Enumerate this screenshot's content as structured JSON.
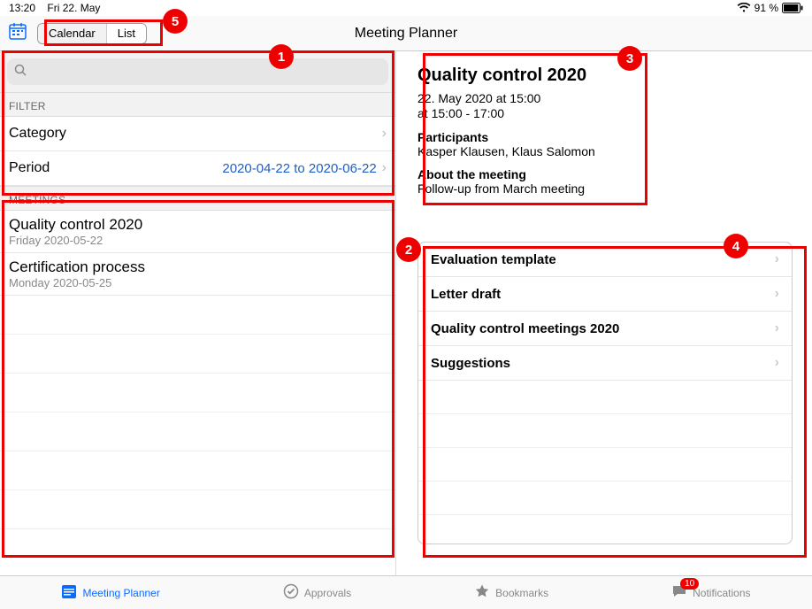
{
  "status": {
    "time": "13:20",
    "date": "Fri 22. May",
    "battery_percent": "91 %"
  },
  "nav": {
    "seg_calendar": "Calendar",
    "seg_list": "List",
    "title": "Meeting Planner"
  },
  "filter": {
    "header": "FILTER",
    "category_label": "Category",
    "period_label": "Period",
    "period_value": "2020-04-22 to 2020-06-22"
  },
  "meetings": {
    "header": "MEETINGS",
    "items": [
      {
        "title": "Quality control 2020",
        "sub": "Friday 2020-05-22"
      },
      {
        "title": "Certification process",
        "sub": "Monday 2020-05-25"
      }
    ]
  },
  "detail": {
    "title": "Quality control 2020",
    "date_line": "22. May 2020 at 15:00",
    "time_line": "at 15:00 - 17:00",
    "participants_label": "Participants",
    "participants": "Kasper Klausen, Klaus Salomon",
    "about_label": "About the meeting",
    "about": "Follow-up from March meeting"
  },
  "documents": {
    "items": [
      {
        "label": "Evaluation template"
      },
      {
        "label": "Letter draft"
      },
      {
        "label": "Quality control meetings 2020"
      },
      {
        "label": "Suggestions"
      }
    ]
  },
  "tabs": {
    "planner": "Meeting Planner",
    "approvals": "Approvals",
    "bookmarks": "Bookmarks",
    "notifications": "Notifications",
    "badge": "10"
  },
  "annotations": {
    "a1": "1",
    "a2": "2",
    "a3": "3",
    "a4": "4",
    "a5": "5"
  }
}
